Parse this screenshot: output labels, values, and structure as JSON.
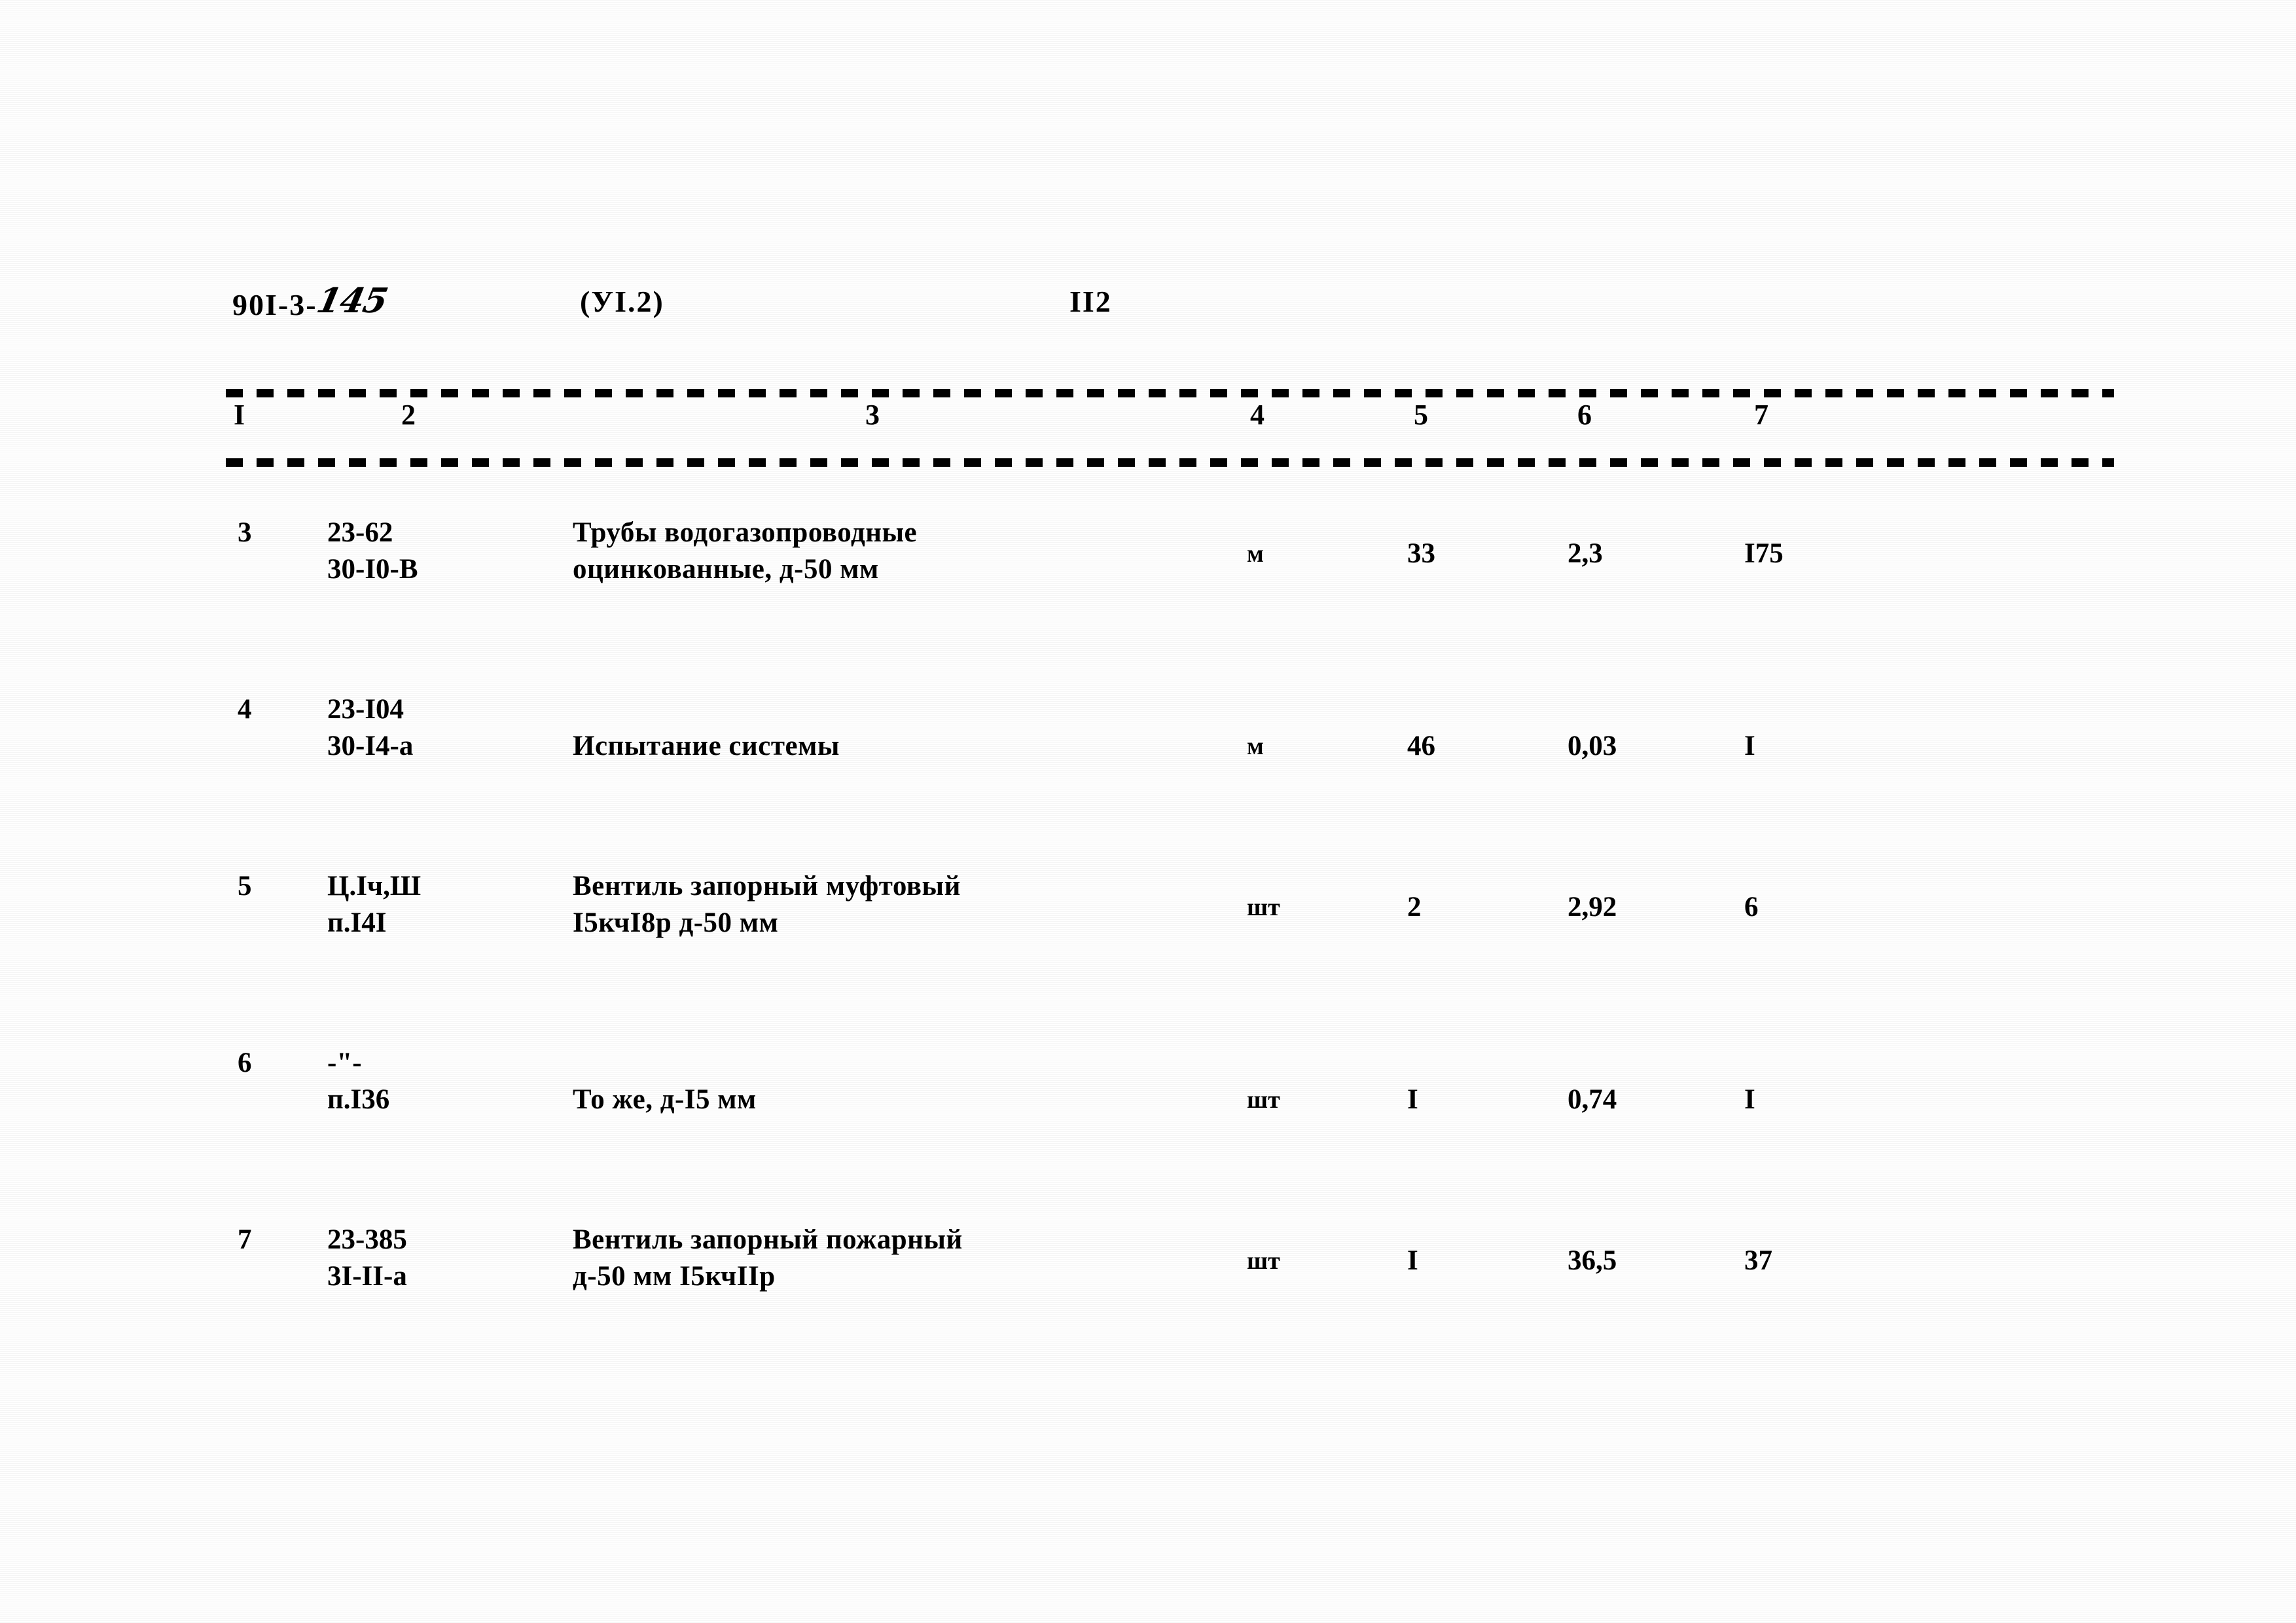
{
  "document": {
    "header": {
      "series_code_prefix": "90I-3-",
      "series_code_handwritten": "145",
      "section": "(УI.2)",
      "page_number": "II2"
    },
    "table": {
      "column_numbers": [
        "I",
        "2",
        "3",
        "4",
        "5",
        "6",
        "7"
      ],
      "rows": [
        {
          "num": "3",
          "code": "23-62\n30-I0-В",
          "description": "Трубы водогазопроводные\nоцинкованные, д-50 мм",
          "unit": "м",
          "quantity": "33",
          "rate": "2,3",
          "total": "I75"
        },
        {
          "num": "4",
          "code": "23-I04\n30-I4-а",
          "description": "Испытание системы",
          "unit": "м",
          "quantity": "46",
          "rate": "0,03",
          "total": "I"
        },
        {
          "num": "5",
          "code": "Ц.Iч,Ш\nп.I4I",
          "description": "Вентиль запорный муфтовый\nI5кчI8р д-50 мм",
          "unit": "шт",
          "quantity": "2",
          "rate": "2,92",
          "total": "6"
        },
        {
          "num": "6",
          "code": "-\"-\nп.I36",
          "description": "То же, д-I5 мм",
          "unit": "шт",
          "quantity": "I",
          "rate": "0,74",
          "total": "I"
        },
        {
          "num": "7",
          "code": "23-385\n3I-II-а",
          "description": "Вентиль запорный пожарный\nд-50 мм I5кчIIр",
          "unit": "шт",
          "quantity": "I",
          "rate": "36,5",
          "total": "37"
        }
      ]
    }
  }
}
